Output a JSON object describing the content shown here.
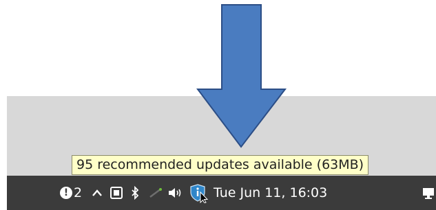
{
  "tooltip": {
    "text": "95 recommended updates available (63MB)"
  },
  "taskbar": {
    "notification_count": "2",
    "clock": "Tue Jun 11, 16:03"
  },
  "colors": {
    "arrow_fill": "#4a7cc0",
    "arrow_stroke": "#2c4e86",
    "taskbar_bg": "#3b3b3b",
    "tooltip_bg": "#ffffc8",
    "update_icon": "#2f86c9"
  },
  "icons": [
    "alert-icon",
    "chevron-up-icon",
    "screenshot-icon",
    "bluetooth-icon",
    "network-icon",
    "volume-icon",
    "update-manager-icon",
    "mouse-cursor-icon",
    "display-icon"
  ]
}
